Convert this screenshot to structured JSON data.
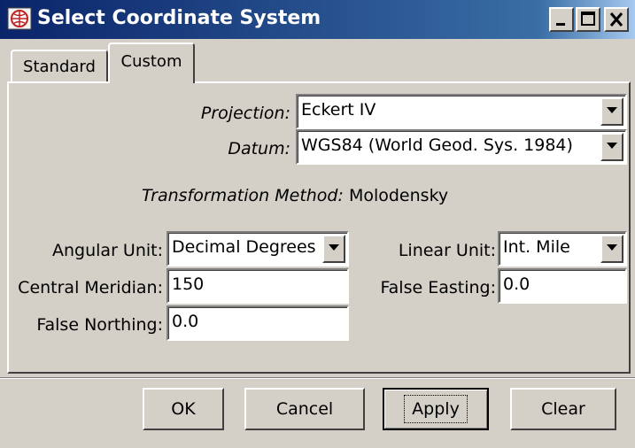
{
  "window": {
    "title": "Select Coordinate System"
  },
  "tabs": [
    {
      "label": "Standard"
    },
    {
      "label": "Custom"
    }
  ],
  "projection": {
    "label": "Projection:",
    "value": "Eckert IV"
  },
  "datum": {
    "label": "Datum:",
    "value": "WGS84 (World Geod. Sys. 1984)"
  },
  "transformation": {
    "label": "Transformation Method:",
    "value": "Molodensky"
  },
  "angular_unit": {
    "label": "Angular Unit:",
    "value": "Decimal Degrees"
  },
  "linear_unit": {
    "label": "Linear Unit:",
    "value": "Int. Mile"
  },
  "central_meridian": {
    "label": "Central Meridian:",
    "value": "150"
  },
  "false_easting": {
    "label": "False Easting:",
    "value": "0.0"
  },
  "false_northing": {
    "label": "False Northing:",
    "value": "0.0"
  },
  "buttons": {
    "ok": "OK",
    "cancel": "Cancel",
    "apply": "Apply",
    "clear": "Clear"
  },
  "colors": {
    "titlebar_start": "#0a246a",
    "titlebar_end": "#a6caf0",
    "face": "#d4d0c8"
  }
}
